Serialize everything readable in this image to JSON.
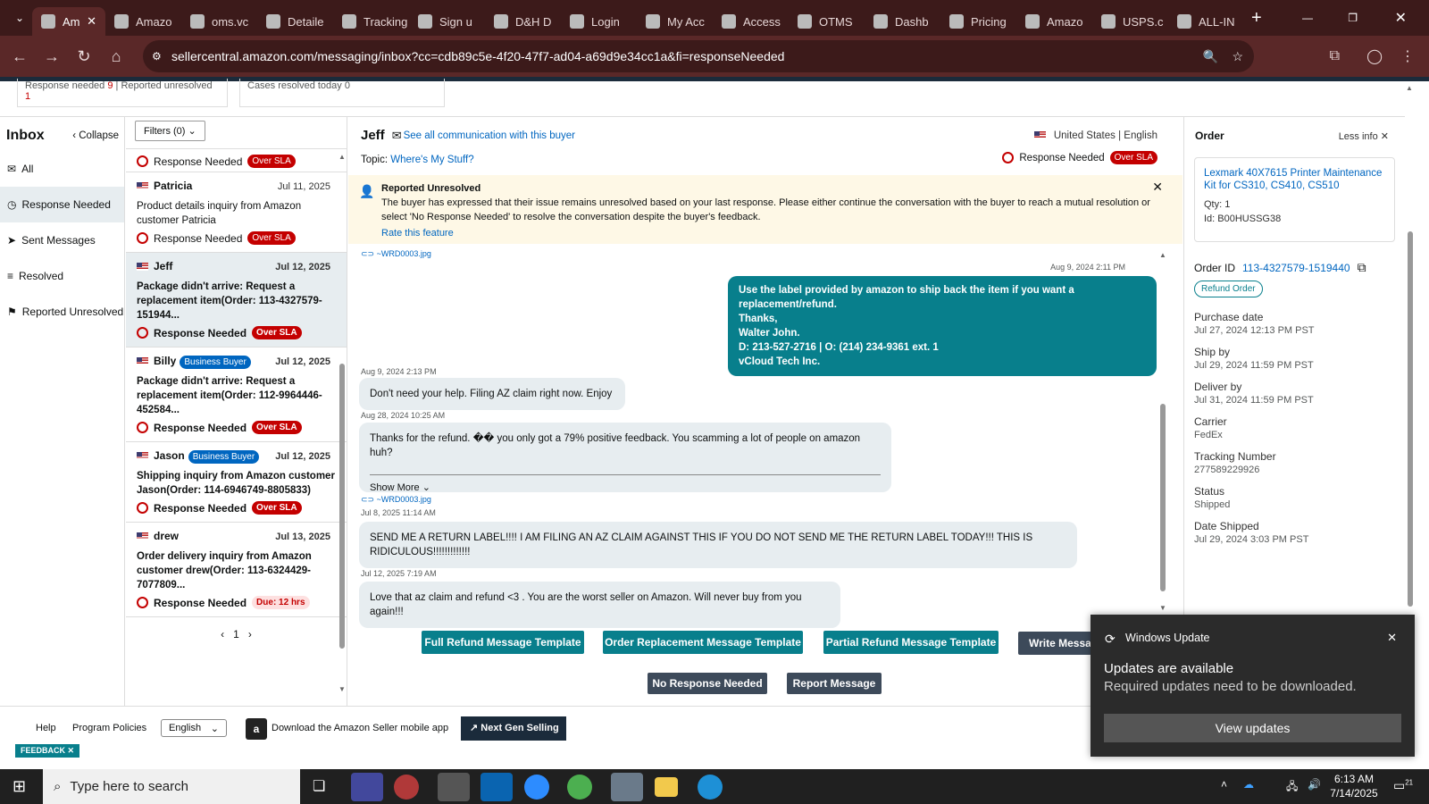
{
  "browser": {
    "tabs": [
      {
        "label": "Am",
        "icon": "amazon-icon",
        "active": true
      },
      {
        "label": "Amazo",
        "icon": "amazon-icon"
      },
      {
        "label": "oms.vc",
        "icon": "oms-icon"
      },
      {
        "label": "Detaile",
        "icon": "detail-icon"
      },
      {
        "label": "Tracking",
        "icon": "ups-icon"
      },
      {
        "label": "Sign u",
        "icon": "signup-icon"
      },
      {
        "label": "D&H D",
        "icon": "dh-icon"
      },
      {
        "label": "Login",
        "icon": "login-icon"
      },
      {
        "label": "My Acc",
        "icon": "myacc-icon"
      },
      {
        "label": "Access",
        "icon": "im-icon"
      },
      {
        "label": "OTMS",
        "icon": "otms-icon"
      },
      {
        "label": "Dashb",
        "icon": "dashboard-icon"
      },
      {
        "label": "Pricing",
        "icon": "pricing-icon"
      },
      {
        "label": "Amazo",
        "icon": "amazon-icon"
      },
      {
        "label": "USPS.c",
        "icon": "usps-icon"
      },
      {
        "label": "ALL-IN",
        "icon": "allin-icon"
      }
    ],
    "url": "sellercentral.amazon.com/messaging/inbox?cc=cdb89c5e-4f20-47f7-ad04-a69d9e34cc1a&fi=responseNeeded"
  },
  "stats": {
    "response_needed_label": "Response needed",
    "response_needed_count": "9",
    "reported_unresolved_label": "Reported unresolved",
    "reported_unresolved_count": "1",
    "cases_resolved_label": "Cases resolved today",
    "cases_resolved_count": "0"
  },
  "nav": {
    "title": "Inbox",
    "collapse": "Collapse",
    "items": [
      {
        "label": "All",
        "icon": "mail-icon"
      },
      {
        "label": "Response Needed",
        "icon": "clock-icon",
        "selected": true
      },
      {
        "label": "Sent Messages",
        "icon": "send-icon"
      },
      {
        "label": "Resolved",
        "icon": "check-icon"
      },
      {
        "label": "Reported Unresolved",
        "icon": "report-icon"
      }
    ]
  },
  "list": {
    "filters": "Filters (0)",
    "partial_status": "Response Needed",
    "partial_badge": "Over SLA",
    "items": [
      {
        "name": "Patricia",
        "date": "Jul 11, 2025",
        "desc": "Product details inquiry from Amazon customer Patricia",
        "status": "Response Needed",
        "badge": "Over SLA"
      },
      {
        "name": "Jeff",
        "date": "Jul 12, 2025",
        "desc": "Package didn't arrive: Request a replacement item(Order: 113-4327579-151944...",
        "status": "Response Needed",
        "badge": "Over SLA"
      },
      {
        "name": "Billy",
        "tag": "Business Buyer",
        "date": "Jul 12, 2025",
        "desc": "Package didn't arrive: Request a replacement item(Order: 112-9964446-452584...",
        "status": "Response Needed",
        "badge": "Over SLA"
      },
      {
        "name": "Jason",
        "tag": "Business Buyer",
        "date": "Jul 12, 2025",
        "desc": "Shipping inquiry from Amazon customer Jason(Order: 114-6946749-8805833)",
        "status": "Response Needed",
        "badge": "Over SLA"
      },
      {
        "name": "drew",
        "date": "Jul 13, 2025",
        "desc": "Order delivery inquiry from Amazon customer drew(Order: 113-6324429-7077809...",
        "status": "Response Needed",
        "badge": "Due: 12 hrs"
      }
    ],
    "page": "1"
  },
  "conversation": {
    "buyer": "Jeff",
    "see_all": "See all communication with this buyer",
    "topic_label": "Topic:",
    "topic": "Where's My Stuff?",
    "country": "United States",
    "language": "English",
    "status": "Response Needed",
    "badge": "Over SLA",
    "banner_title": "Reported Unresolved",
    "banner_text": "The buyer has expressed that their issue remains unresolved based on your last response. Please either continue the conversation with the buyer to reach a mutual resolution or select 'No Response Needed' to resolve the conversation despite the buyer's feedback.",
    "banner_link": "Rate this feature",
    "attachment1": "~WRD0003.jpg",
    "ts1": "Aug 9, 2024 2:11 PM",
    "out_msg": [
      "Use the label provided by amazon to ship back the item if you want a replacement/refund.",
      "Thanks,",
      "Walter John.",
      "D: 213-527-2716 | O: (214) 234-9361 ext. 1",
      "vCloud Tech Inc."
    ],
    "ts2": "Aug 9, 2024 2:13 PM",
    "msg2": "Don't need your help.  Filing AZ claim right now.  Enjoy",
    "ts3": "Aug 28, 2024 10:25 AM",
    "msg3": "Thanks for the refund.  ��  you only got a 79% positive feedback.  You scamming a lot of people on amazon huh?",
    "show_more": "Show More",
    "attachment2": "~WRD0003.jpg",
    "ts4": "Jul 8, 2025 11:14 AM",
    "msg4": "SEND ME A RETURN LABEL!!!!  I AM FILING AN AZ CLAIM AGAINST THIS IF YOU DO NOT SEND ME THE RETURN LABEL TODAY!!!  THIS IS RIDICULOUS!!!!!!!!!!!!!",
    "ts5": "Jul 12, 2025 7:19 AM",
    "msg5": "Love that az claim and refund <3 .  You are the worst seller on Amazon.  Will never buy from you again!!!",
    "buttons": [
      "Full Refund Message Template",
      "Order Replacement Message Template",
      "Partial Refund Message Template",
      "Write Message"
    ],
    "no_response": "No Response Needed",
    "report": "Report Message"
  },
  "order": {
    "title": "Order",
    "less_info": "Less info",
    "product": "Lexmark 40X7615 Printer Maintenance Kit for CS310, CS410, CS510",
    "qty": "Qty: 1",
    "id": "Id: B00HUSSG38",
    "order_id_label": "Order ID",
    "order_id": "113-4327579-1519440",
    "refund_btn": "Refund Order",
    "fields": [
      {
        "label": "Purchase date",
        "value": "Jul 27, 2024 12:13 PM PST"
      },
      {
        "label": "Ship by",
        "value": "Jul 29, 2024 11:59 PM PST"
      },
      {
        "label": "Deliver by",
        "value": "Jul 31, 2024 11:59 PM PST"
      },
      {
        "label": "Carrier",
        "value": "FedEx"
      },
      {
        "label": "Tracking Number",
        "value": "277589229926"
      },
      {
        "label": "Status",
        "value": "Shipped"
      },
      {
        "label": "Date Shipped",
        "value": "Jul 29, 2024 3:03 PM PST"
      }
    ]
  },
  "footer": {
    "help": "Help",
    "policies": "Program Policies",
    "language": "English",
    "download": "Download the Amazon Seller mobile app",
    "next_gen": "Next Gen Selling",
    "feedback": "FEEDBACK"
  },
  "toast": {
    "app": "Windows Update",
    "title": "Updates are available",
    "text": "Required updates need to be downloaded.",
    "button": "View updates"
  },
  "taskbar": {
    "search_placeholder": "Type here to search",
    "time": "6:13 AM",
    "date": "7/14/2025",
    "notif_count": "21"
  }
}
